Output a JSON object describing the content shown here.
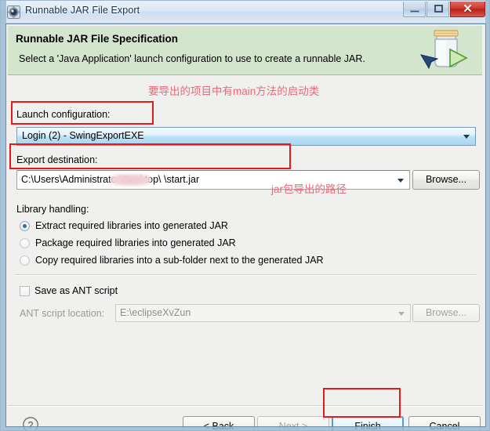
{
  "window": {
    "title": "Runnable JAR File Export",
    "icon": "eclipse-export-icon",
    "controls": {
      "minimize": "–",
      "maximize": "□",
      "close": "✕"
    }
  },
  "banner": {
    "title": "Runnable JAR File Specification",
    "description": "Select a 'Java Application' launch configuration to use to create a runnable JAR.",
    "graphic": "jar-with-run-arrow-icon",
    "background_color": "#d3e6cd"
  },
  "form": {
    "launch_configuration": {
      "label": "Launch configuration:",
      "value": "Login (2) - SwingExportEXE",
      "selected": true
    },
    "export_destination": {
      "label": "Export destination:",
      "value": "C:\\Users\\Administrator\\Desktop\\            \\start.jar",
      "value_prefix": "C:\\Users\\Administrator\\Desktop\\",
      "value_suffix": "\\start.jar",
      "redacted": true,
      "browse_label": "Browse..."
    },
    "library_handling": {
      "label": "Library handling:",
      "options": [
        {
          "label": "Extract required libraries into generated JAR",
          "checked": true
        },
        {
          "label": "Package required libraries into generated JAR",
          "checked": false
        },
        {
          "label": "Copy required libraries into a sub-folder next to the generated JAR",
          "checked": false
        }
      ]
    },
    "save_as_ant": {
      "label": "Save as ANT script",
      "checked": false
    },
    "ant_script_location": {
      "label": "ANT script location:",
      "value": "E:\\eclipseXvZun",
      "browse_label": "Browse...",
      "disabled": true
    }
  },
  "buttons": {
    "help": "?",
    "back": "< Back",
    "next": "Next >",
    "finish": "Finish",
    "cancel": "Cancel",
    "next_disabled": true,
    "finish_focused": true
  },
  "annotations": {
    "accent_color": "#e8191b",
    "text_color": "#e76a78",
    "launch_note": "要导出的项目中有main方法的启动类",
    "destination_note": "jar包导出的路径"
  }
}
